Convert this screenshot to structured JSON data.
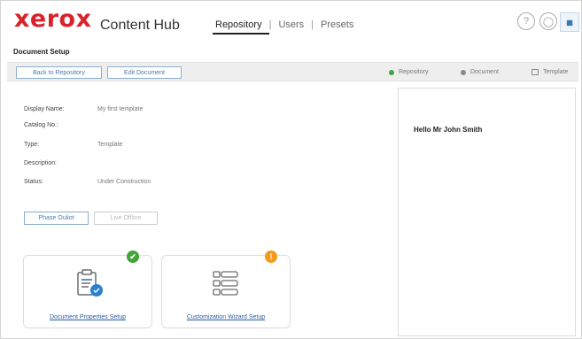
{
  "header": {
    "logo": "xerox",
    "app_name": "Content Hub",
    "tabs": [
      {
        "label": "Repository",
        "active": true
      },
      {
        "label": "Users",
        "active": false
      },
      {
        "label": "Presets",
        "active": false
      }
    ],
    "separator": "|",
    "help_icon": "question-circle-icon",
    "user_icon": "user-circle-icon",
    "apps_icon": "apps-grid-icon",
    "help_glyph": "?",
    "user_glyph": "◯",
    "apps_glyph": "▦"
  },
  "page": {
    "title": "Document Setup"
  },
  "toolbar": {
    "back_label": "Back to Repository",
    "edit_label": "Edit Document",
    "legend": [
      {
        "label": "Repository",
        "color": "#43a047",
        "icon": "dot"
      },
      {
        "label": "Document",
        "color": "#8a8a8a",
        "icon": "dot"
      },
      {
        "label": "Template",
        "color": "#8a8a8a",
        "icon": "document-icon"
      }
    ]
  },
  "properties": [
    {
      "label": "Display Name:",
      "value": "My first template"
    },
    {
      "label": "Catalog No.:",
      "value": ""
    },
    {
      "label": "Type:",
      "value": "Template"
    },
    {
      "label": "Description:",
      "value": ""
    },
    {
      "label": "Status:",
      "value": "Under Construction"
    }
  ],
  "actions": {
    "primary_label": "Phase Ouliot",
    "secondary_label": "Live Offline"
  },
  "cards": [
    {
      "link": "Document Properties Setup",
      "badge": "✔",
      "badge_color": "#3fa535",
      "icon": "document-properties-icon"
    },
    {
      "link": "Customization Wizard Setup",
      "badge": "!",
      "badge_color": "#f39a1b",
      "icon": "wizard-list-icon"
    }
  ],
  "preview": {
    "text": "Hello Mr John Smith"
  },
  "colors": {
    "brand": "#d8232a",
    "accent": "#2b5ea8"
  }
}
